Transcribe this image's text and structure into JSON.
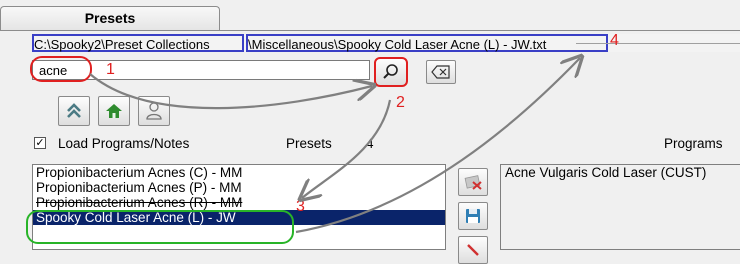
{
  "tab": {
    "label": "Presets"
  },
  "path": {
    "segment1": "C:\\Spooky2\\Preset Collections",
    "segment2": "\\Miscellaneous\\Spooky Cold Laser Acne (L) - JW.txt"
  },
  "search": {
    "value": "acne",
    "placeholder": ""
  },
  "annotations": {
    "n1": "1",
    "n2": "2",
    "n3": "3",
    "n4": "4"
  },
  "options": {
    "load_programs_label": "Load Programs/Notes",
    "load_programs_checked": true,
    "checkmark": "✓",
    "presets_label": "Presets",
    "presets_count": "4",
    "programs_label": "Programs"
  },
  "presets_list": [
    {
      "label": "Propionibacterium Acnes (C) - MM"
    },
    {
      "label": "Propionibacterium Acnes (P) - MM"
    },
    {
      "label": "Propionibacterium Acnes (R) - MM"
    },
    {
      "label": "Spooky Cold Laser Acne (L) - JW"
    }
  ],
  "programs_list": [
    {
      "label": "Acne Vulgaris Cold Laser (CUST)"
    }
  ],
  "icons": {
    "search": "magnifier-icon",
    "clear": "backspace-icon",
    "up": "double-chevron-up-icon",
    "home": "home-icon",
    "user": "person-icon"
  },
  "colors": {
    "selection": "#0a246a",
    "annotation_red": "#e02020",
    "annotation_blue": "#3a3fc6",
    "annotation_green": "#28b428",
    "arrow_gray": "#808080"
  }
}
